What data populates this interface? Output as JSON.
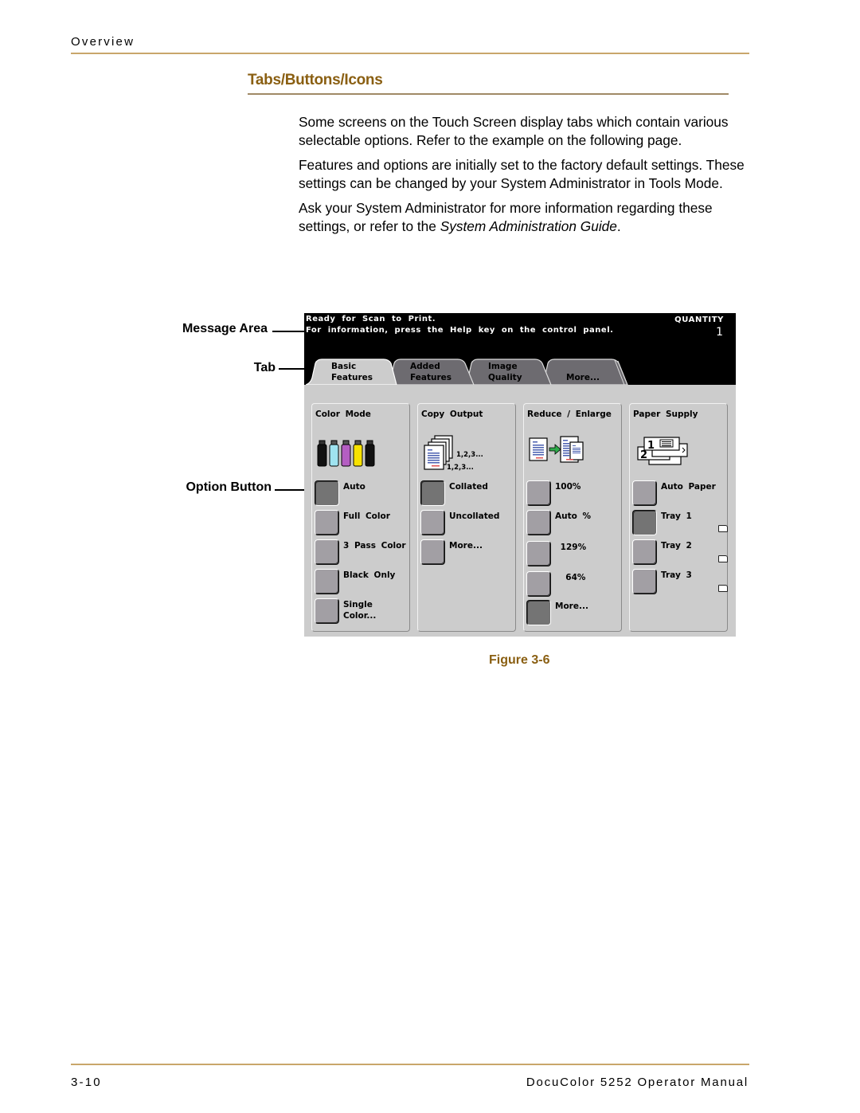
{
  "header": {
    "running_head": "Overview"
  },
  "section": {
    "title": "Tabs/Buttons/Icons"
  },
  "body": {
    "p1": "Some screens on the Touch Screen display tabs which contain various selectable options. Refer to the example on the following page.",
    "p2": "Features and options are initially set to the factory default settings. These settings can be changed by your System Administrator in Tools Mode.",
    "p3_prefix": "Ask your System Administrator for more information regarding these settings, or refer to the ",
    "p3_italic": "System Administration Guide",
    "p3_suffix": "."
  },
  "callouts": {
    "message_area": "Message Area",
    "tab": "Tab",
    "option_button": "Option Button"
  },
  "screen": {
    "message_line1": "Ready for Scan to Print.",
    "message_line2": "For information, press the Help key on the control panel.",
    "quantity_label": "QUANTITY",
    "quantity_value": "1",
    "tabs": [
      {
        "label": "Basic\nFeatures",
        "active": true
      },
      {
        "label": "Added\nFeatures",
        "active": false
      },
      {
        "label": "Image\nQuality",
        "active": false
      },
      {
        "label": "\nMore...",
        "active": false
      }
    ],
    "panels": [
      {
        "title": "Color Mode",
        "icon": "toner-bottles-icon",
        "options": [
          {
            "label": "Auto",
            "selected": true
          },
          {
            "label": "Full Color",
            "selected": false
          },
          {
            "label": "3 Pass Color",
            "selected": false
          },
          {
            "label": "Black Only",
            "selected": false
          },
          {
            "label": "Single\nColor...",
            "selected": false
          }
        ]
      },
      {
        "title": "Copy Output",
        "icon": "collated-pages-icon",
        "icon_text_1": "1,2,3...",
        "icon_text_2": "1,2,3...",
        "options": [
          {
            "label": "Collated",
            "selected": true
          },
          {
            "label": "Uncollated",
            "selected": false
          },
          {
            "label": "More...",
            "selected": false
          }
        ]
      },
      {
        "title": "Reduce / Enlarge",
        "icon": "reduce-enlarge-icon",
        "options": [
          {
            "label": "100%",
            "selected": false
          },
          {
            "label": "Auto %",
            "selected": false
          },
          {
            "label": " 129%",
            "selected": false
          },
          {
            "label": "  64%",
            "selected": false
          },
          {
            "label": "More...",
            "selected": true
          }
        ]
      },
      {
        "title": "Paper Supply",
        "icon": "paper-trays-icon",
        "options": [
          {
            "label": "Auto Paper",
            "selected": false
          },
          {
            "label": "Tray 1",
            "selected": true
          },
          {
            "label": "Tray 2",
            "selected": false
          },
          {
            "label": "Tray 3",
            "selected": false
          }
        ]
      }
    ]
  },
  "figure": {
    "caption": "Figure 3-6"
  },
  "footer": {
    "page_number": "3-10",
    "manual_title": "DocuColor 5252 Operator Manual"
  }
}
